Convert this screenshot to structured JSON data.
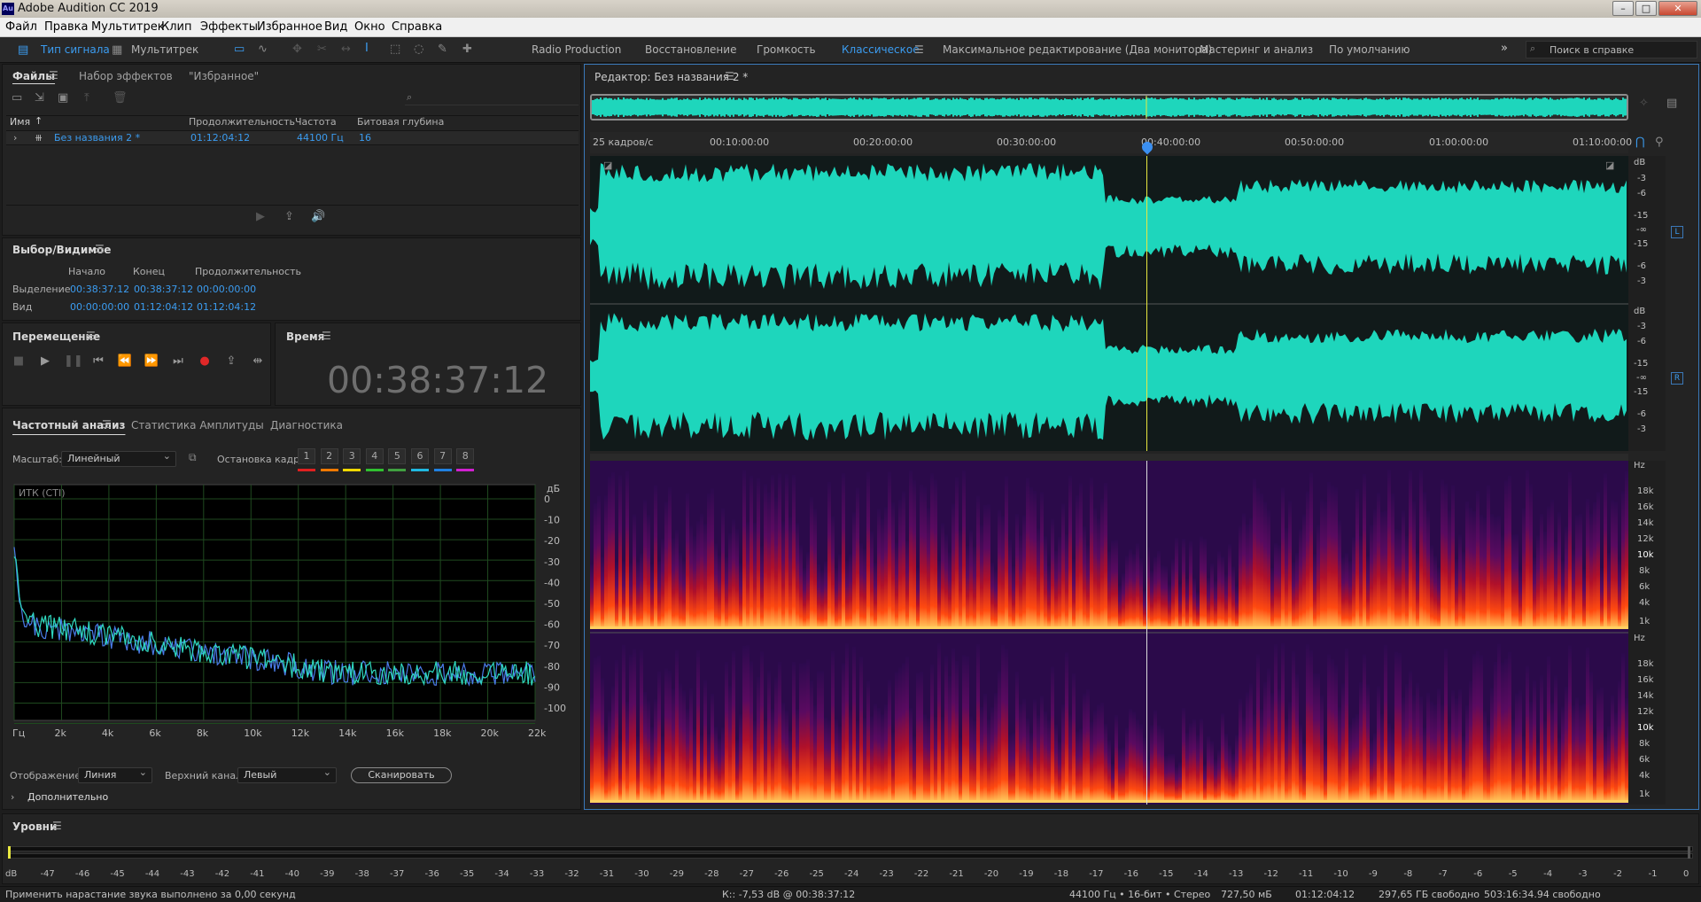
{
  "window": {
    "title": "Adobe Audition CC 2019",
    "logo": "Au"
  },
  "menu": [
    "Файл",
    "Правка",
    "Мультитрек",
    "Клип",
    "Эффекты",
    "Избранное",
    "Вид",
    "Окно",
    "Справка"
  ],
  "toolbar": {
    "waveform_tab": "Тип сигнала",
    "multitrack_tab": "Мультитрек",
    "workspaces": [
      "Radio Production",
      "Восстановление",
      "Громкость",
      "Классическое",
      "Максимальное редактирование (Два монитора)",
      "Мастеринг и анализ",
      "По умолчанию"
    ],
    "active_workspace": "Классическое",
    "search_placeholder": "Поиск в справке"
  },
  "files": {
    "tab_files": "Файлы",
    "tab_effects": "Набор эффектов",
    "tab_favorites": "\"Избранное\"",
    "columns": [
      "Имя",
      "Продолжительность",
      "Частота",
      "Битовая глубина"
    ],
    "rows": [
      {
        "name": "Без названия 2 *",
        "duration": "01:12:04:12",
        "rate": "44100 Гц",
        "depth": "16"
      }
    ]
  },
  "selection": {
    "title": "Выбор/Видимое",
    "headers": [
      "Начало",
      "Конец",
      "Продолжительность"
    ],
    "rows": [
      {
        "label": "Выделение",
        "start": "00:38:37:12",
        "end": "00:38:37:12",
        "duration": "00:00:00:00"
      },
      {
        "label": "Вид",
        "start": "00:00:00:00",
        "end": "01:12:04:12",
        "duration": "01:12:04:12"
      }
    ]
  },
  "transport": {
    "title": "Перемещение"
  },
  "time": {
    "title": "Время",
    "value": "00:38:37:12"
  },
  "frequency": {
    "tab_analysis": "Частотный анализ",
    "tab_amp": "Статистика Амплитуды",
    "tab_diag": "Диагностика",
    "scale_label": "Масштаб:",
    "scale_value": "Линейный",
    "freeze_label": "Остановка кадра:",
    "slots": [
      "1",
      "2",
      "3",
      "4",
      "5",
      "6",
      "7",
      "8"
    ],
    "slot_colors": [
      "#e02020",
      "#f07800",
      "#f0d800",
      "#30c030",
      "#40a040",
      "#20b8e0",
      "#2080e0",
      "#d020d0"
    ],
    "chart_label": "ИТК (СТІ)",
    "db_unit": "дБ",
    "db_ticks": [
      "0",
      "-10",
      "-20",
      "-30",
      "-40",
      "-50",
      "-60",
      "-70",
      "-80",
      "-90",
      "-100"
    ],
    "freq_ticks": [
      "Гц",
      "2k",
      "4k",
      "6k",
      "8k",
      "10k",
      "12k",
      "14k",
      "16k",
      "18k",
      "20k",
      "22k"
    ],
    "display_label": "Отображение:",
    "display_value": "Линия",
    "channel_label": "Верхний канал:",
    "channel_value": "Левый",
    "scan_button": "Сканировать",
    "advanced": "Дополнительно"
  },
  "editor": {
    "title": "Редактор: Без названия 2 *",
    "fps": "25 кадров/с",
    "timeline": [
      "00:10:00:00",
      "00:20:00:00",
      "00:30:00:00",
      "00:40:00:00",
      "00:50:00:00",
      "01:00:00:00",
      "01:10:00:00"
    ],
    "db_scale": [
      "dB",
      "-3",
      "-6",
      "-15",
      "-∞",
      "-15",
      "-6",
      "-3"
    ],
    "channel_l": "L",
    "channel_r": "R",
    "hz_scale": [
      "Hz",
      "18k",
      "16k",
      "14k",
      "12k",
      "10k",
      "8k",
      "6k",
      "4k",
      "1k"
    ],
    "wave_color": "#1ed6bc"
  },
  "levels": {
    "title": "Уровни",
    "ticks": [
      "dB",
      "-47",
      "-46",
      "-45",
      "-44",
      "-43",
      "-42",
      "-41",
      "-40",
      "-39",
      "-38",
      "-37",
      "-36",
      "-35",
      "-34",
      "-33",
      "-32",
      "-31",
      "-30",
      "-29",
      "-28",
      "-27",
      "-26",
      "-25",
      "-24",
      "-23",
      "-22",
      "-21",
      "-20",
      "-19",
      "-18",
      "-17",
      "-16",
      "-15",
      "-14",
      "-13",
      "-12",
      "-11",
      "-10",
      "-9",
      "-8",
      "-7",
      "-6",
      "-5",
      "-4",
      "-3",
      "-2",
      "-1",
      "0"
    ]
  },
  "status": {
    "message": "Применить нарастание звука выполнено за 0,00 секунд",
    "cursor": "К:: -7,53 dB @ 00:38:37:12",
    "format": "44100 Гц • 16-бит • Стерео",
    "size": "727,50 мБ",
    "duration": "01:12:04:12",
    "free": "297,65 ГБ свободно",
    "free_time": "503:16:34.94 свободно"
  }
}
